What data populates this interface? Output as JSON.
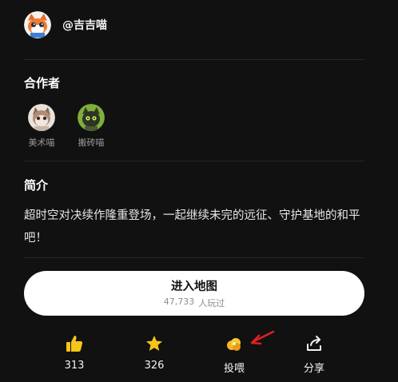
{
  "author": {
    "name": "@吉吉喵"
  },
  "collaborators": {
    "title": "合作者",
    "items": [
      {
        "name": "美术喵"
      },
      {
        "name": "搬砖喵"
      }
    ]
  },
  "intro": {
    "title": "简介",
    "text": "超时空对决续作隆重登场，一起继续未完的远征、守护基地的和平吧！"
  },
  "enter": {
    "label": "进入地图",
    "play_count": "47,733",
    "play_suffix": "人玩过"
  },
  "actions": {
    "like_count": "313",
    "favorite_count": "326",
    "feed_label": "投喂",
    "share_label": "分享"
  },
  "colors": {
    "background": "#111111",
    "accent_yellow": "#f5c518",
    "annotation_red": "#e02020"
  }
}
